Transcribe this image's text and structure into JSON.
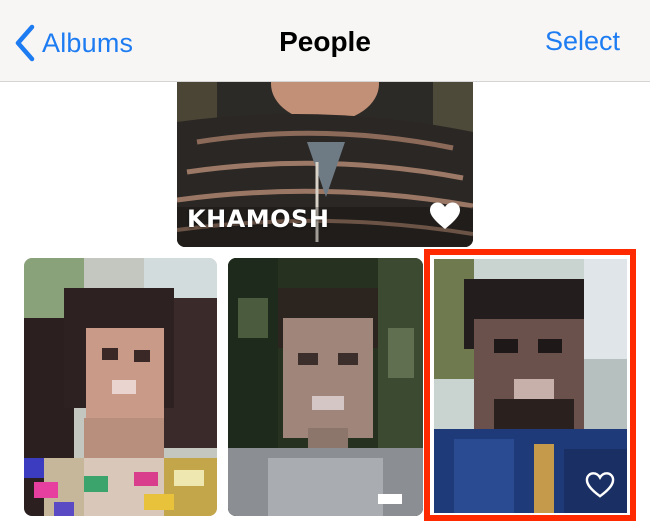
{
  "nav": {
    "back_label": "Albums",
    "title": "People",
    "select_label": "Select"
  },
  "people": [
    {
      "name": "KHAMOSH",
      "favorite": true
    },
    {
      "name": "",
      "favorite": false
    },
    {
      "name": "",
      "favorite": false
    },
    {
      "name": "",
      "favorite": true
    }
  ],
  "colors": {
    "accent": "#1e7cf2",
    "highlight": "#ff2a00"
  },
  "icons": {
    "back": "chevron-left-icon",
    "favorite": "heart-icon"
  }
}
